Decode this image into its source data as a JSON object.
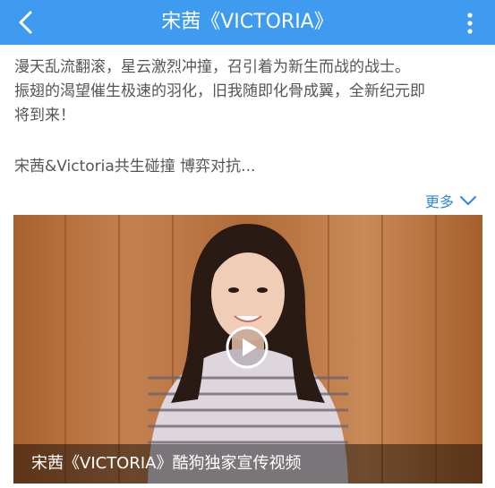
{
  "header": {
    "title": "宋茜《VICTORIA》",
    "back_icon": "chevron-left-icon",
    "menu_icon": "more-vertical-icon",
    "bg_color": "#3f9bf0"
  },
  "description": {
    "lines": [
      "漫天乱流翻滚，星云激烈冲撞，召引着为新生而战的战士。",
      "振翅的渴望催生极速的羽化，旧我随即化骨成翼，全新纪元即",
      "将到来！"
    ],
    "summary": "宋茜&Victoria共生碰撞 博弈对抗..."
  },
  "more": {
    "label": "更多",
    "icon": "chevron-down-icon",
    "color": "#2d86e6"
  },
  "video": {
    "caption": "宋茜《VICTORIA》酷狗独家宣传视频",
    "play_icon": "play-icon"
  }
}
